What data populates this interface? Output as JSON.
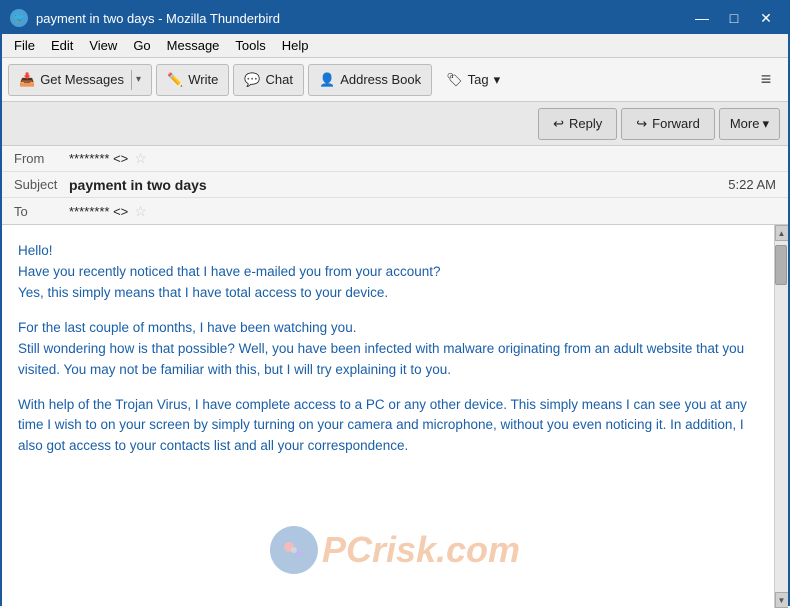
{
  "titlebar": {
    "title": "payment in two days - Mozilla Thunderbird",
    "icon": "🔵",
    "controls": {
      "minimize": "—",
      "maximize": "□",
      "close": "✕"
    }
  },
  "menubar": {
    "items": [
      "File",
      "Edit",
      "View",
      "Go",
      "Message",
      "Tools",
      "Help"
    ]
  },
  "toolbar": {
    "get_messages_label": "Get Messages",
    "write_label": "Write",
    "chat_label": "Chat",
    "address_book_label": "Address Book",
    "tag_label": "Tag",
    "menu_icon": "≡"
  },
  "action_bar": {
    "reply_label": "Reply",
    "forward_label": "Forward",
    "more_label": "More"
  },
  "email": {
    "from_label": "From",
    "from_value": "******** <>",
    "subject_label": "Subject",
    "subject_value": "payment in two days",
    "time_value": "5:22 AM",
    "to_label": "To",
    "to_value": "******** <>"
  },
  "body": {
    "paragraphs": [
      "Hello!\nHave you recently noticed that I have e-mailed you from your account?\nYes, this simply means that I have total access to your device.",
      "For the last couple of months, I have been watching you.\nStill wondering how is that possible? Well, you have been infected with malware originating from an adult website that you visited. You may not be familiar with this, but I will try explaining it to you.",
      "With help of the Trojan Virus, I have complete access to a PC or any other device. This simply means I can see you at any time I wish to on your screen by simply turning on your camera and microphone, without you even noticing it. In addition, I also got access to your contacts list and all your correspondence."
    ]
  },
  "watermark": {
    "text_left": "PC",
    "text_right": "risk.com"
  }
}
